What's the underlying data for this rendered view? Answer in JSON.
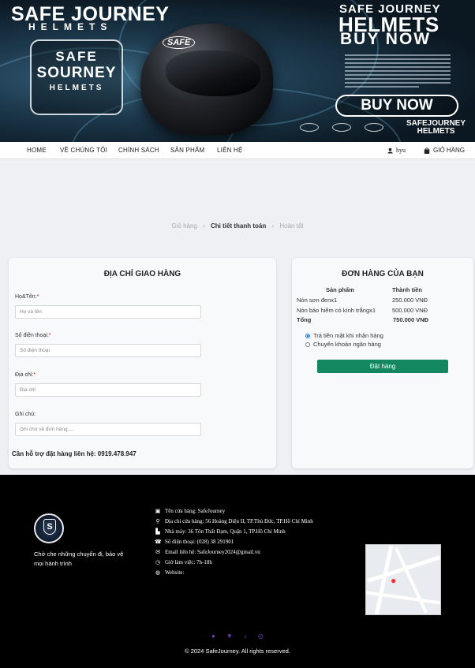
{
  "banner": {
    "brand_title": "SAFE JOURNEY",
    "brand_subtitle": "HELMETS",
    "badge_line1": "SAFE",
    "badge_line2": "SOURNEY",
    "badge_line3": "HELMETS",
    "helmet_logo": "SAFE",
    "promo_line1": "SAFE JOURNEY",
    "promo_line2": "HELMETS",
    "promo_line3": "BUY NOW",
    "buy_button": "BUY NOW",
    "brand_bottom_line1": "SAFEJOURNEY",
    "brand_bottom_line2": "HELMETS"
  },
  "nav": {
    "items": [
      "HOME",
      "VỀ CHÚNG TÔI",
      "CHÍNH SÁCH",
      "SẢN PHẨM",
      "LIÊN HỆ"
    ],
    "user": "hyu",
    "cart": "GIỎ HÀNG"
  },
  "breadcrumb": {
    "step1": "Giỏ hàng",
    "step2": "Chi tiết thanh toán",
    "step3": "Hoàn tất"
  },
  "shipping": {
    "title": "ĐỊA CHỈ GIAO HÀNG",
    "name_label": "Họ&Tên:",
    "name_placeholder": "Họ và tên",
    "phone_label": "Số điện thoại:",
    "phone_placeholder": "Số điện thoại",
    "address_label": "Địa chỉ:",
    "address_placeholder": "Địa chỉ",
    "note_label": "Ghi chú:",
    "note_placeholder": "Ghi chú về đơn hàng.....",
    "required_mark": "*",
    "support_text": "Cần hỗ trợ đặt hàng liên hệ: 0919.478.947"
  },
  "order": {
    "title": "ĐƠN HÀNG CỦA BẠN",
    "col_product": "Sản phẩm",
    "col_total": "Thành tiền",
    "items": [
      {
        "name": "Nón sơn đenx1",
        "price": "250.000 VNĐ"
      },
      {
        "name": "Nón bảo hiểm có kính trắngx1",
        "price": "500.000 VNĐ"
      }
    ],
    "total_label": "Tổng",
    "total_value": "750.000 VNĐ",
    "payment_cod": "Trả tiền mặt khi nhận hàng",
    "payment_transfer": "Chuyển khoản ngân hàng",
    "selected_payment": "Trả tiền mặt khi nhận hàng",
    "place_order_button": "Đặt hàng",
    "button_color": "#128760"
  },
  "footer": {
    "tagline": "Chở che những chuyến đi, bảo vệ mọi hành trình",
    "info": [
      {
        "icon": "store-icon",
        "text": "Tên cửa hàng: SafeJourney"
      },
      {
        "icon": "location-icon",
        "text": "Địa chỉ cửa hàng: 56 Hoàng Diệu II, TP.Thủ Đức, TP.Hồ Chí Minh"
      },
      {
        "icon": "factory-icon",
        "text": "Nhà máy: 36 Tôn Thất Đạm, Quận 1, TP.Hồ Chí Minh"
      },
      {
        "icon": "phone-icon",
        "text": "Số điện thoại: (028) 38 291901"
      },
      {
        "icon": "email-icon",
        "text": "Email liên hệ: SafeJourney2024@gmail.vn"
      },
      {
        "icon": "clock-icon",
        "text": "Giờ làm việc: 7h-18h"
      },
      {
        "icon": "globe-icon",
        "text": "Website:"
      }
    ],
    "copyright": "© 2024 SafeJourney. All rights reserved."
  }
}
